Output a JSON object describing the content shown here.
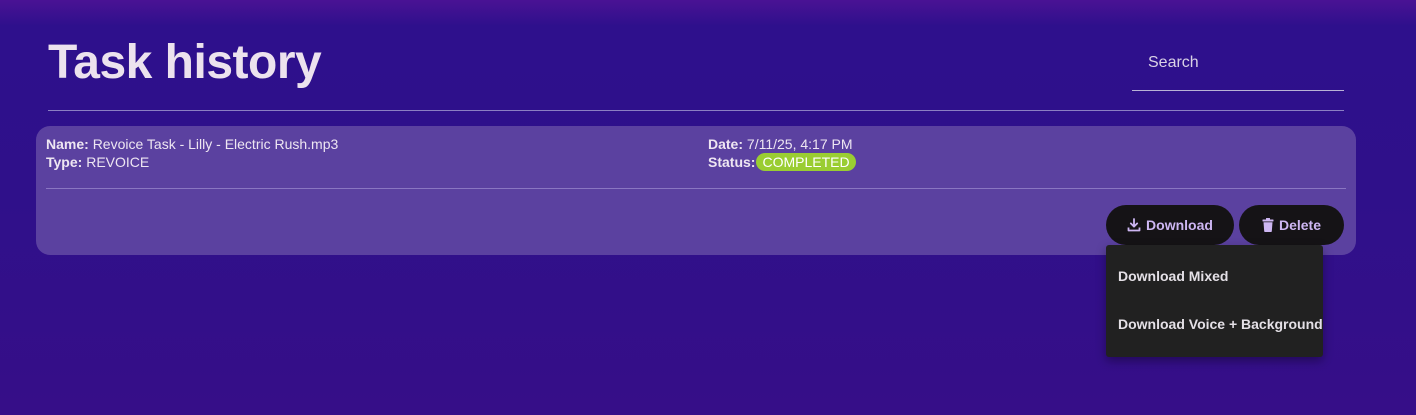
{
  "header": {
    "title": "Task history",
    "search_placeholder": "Search",
    "search_value": ""
  },
  "task": {
    "name_label": "Name:",
    "name_value": "Revoice Task - Lilly - Electric Rush.mp3",
    "type_label": "Type:",
    "type_value": "REVOICE",
    "date_label": "Date:",
    "date_value": "7/11/25, 4:17 PM",
    "status_label": "Status:",
    "status_value": "COMPLETED",
    "actions": {
      "download_label": "Download",
      "download_icon": "download-icon",
      "delete_label": "Delete",
      "delete_icon": "trash-icon"
    }
  },
  "download_menu": {
    "items": [
      {
        "label": "Download Mixed"
      },
      {
        "label": "Download Voice + Background"
      }
    ]
  },
  "colors": {
    "background": "#2f108a",
    "card": "#5b41a0",
    "status_completed": "#9acd32",
    "button_bg": "#151316",
    "button_text": "#cdb6f2",
    "menu_bg": "#212121"
  }
}
